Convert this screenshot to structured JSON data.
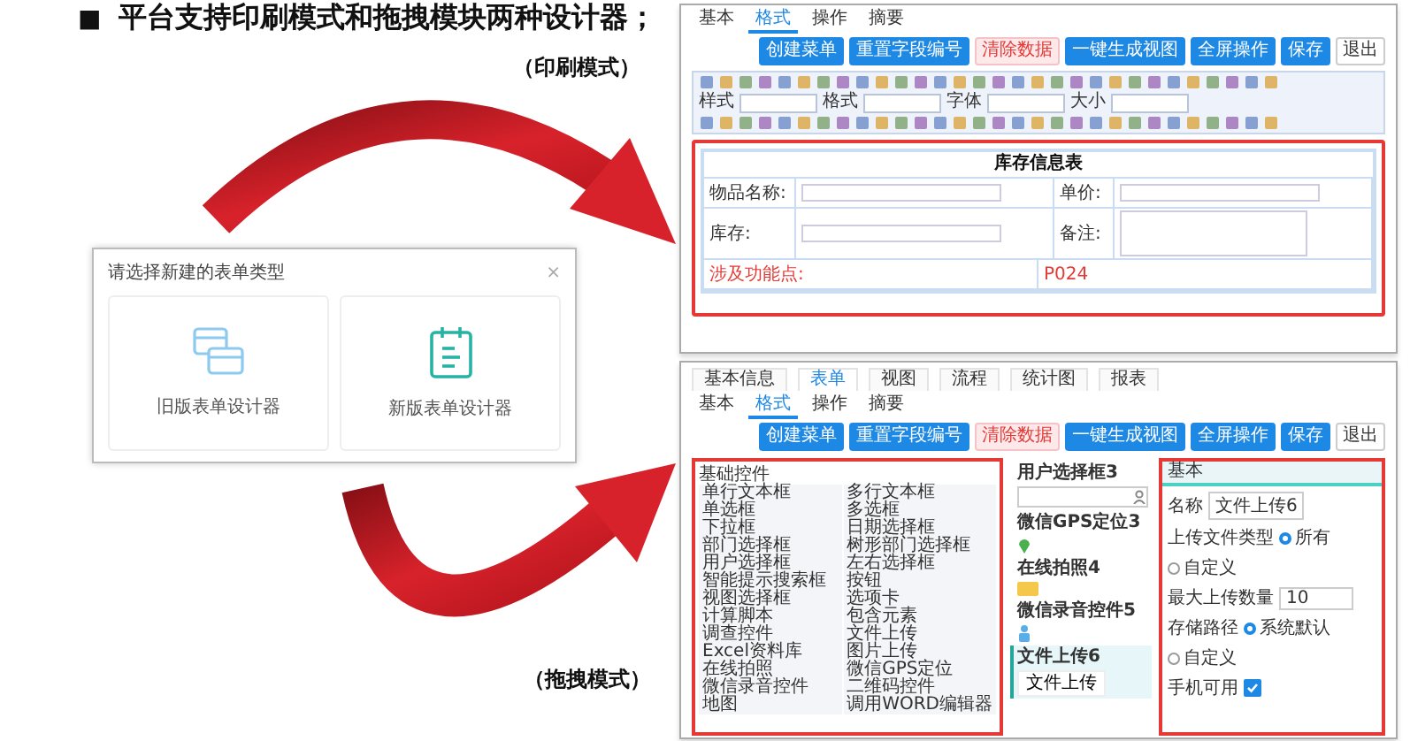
{
  "heading": {
    "bullet": "■",
    "text": "平台支持印刷模式和拖拽模块两种设计器；"
  },
  "mode_labels": [
    "（印刷模式）",
    "（拖拽模式）"
  ],
  "print_designer": {
    "sub_tabs": [
      {
        "label": "基本",
        "selected": false
      },
      {
        "label": "格式",
        "selected": true
      },
      {
        "label": "操作",
        "selected": false
      },
      {
        "label": "摘要",
        "selected": false
      }
    ],
    "buttons": [
      {
        "label": "创建菜单",
        "kind": "primary"
      },
      {
        "label": "重置字段编号",
        "kind": "primary"
      },
      {
        "label": "清除数据",
        "kind": "danger"
      },
      {
        "label": "一键生成视图",
        "kind": "primary"
      },
      {
        "label": "全屏操作",
        "kind": "primary"
      },
      {
        "label": "保存",
        "kind": "primary"
      },
      {
        "label": "退出",
        "kind": "plain"
      }
    ],
    "toolbar_fields": [
      "样式",
      "格式",
      "字体",
      "大小"
    ],
    "form": {
      "title": "库存信息表",
      "rows": [
        {
          "kind": "pair",
          "cells": [
            {
              "label": "物品名称:",
              "kind": "input"
            },
            {
              "label": "单价:",
              "kind": "input"
            }
          ]
        },
        {
          "kind": "pair",
          "cells": [
            {
              "label": "库存:",
              "kind": "input"
            },
            {
              "label": "备注:",
              "kind": "textarea"
            }
          ]
        },
        {
          "kind": "note",
          "label": "涉及功能点:",
          "value": "P024"
        }
      ]
    }
  },
  "dialog": {
    "title": "请选择新建的表单类型",
    "close": "×",
    "options": [
      {
        "label": "旧版表单设计器",
        "kind": "old"
      },
      {
        "label": "新版表单设计器",
        "kind": "new"
      }
    ]
  },
  "drag_designer": {
    "top_tabs": [
      {
        "label": "基本信息",
        "selected": false
      },
      {
        "label": "表单",
        "selected": true
      },
      {
        "label": "视图",
        "selected": false
      },
      {
        "label": "流程",
        "selected": false
      },
      {
        "label": "统计图",
        "selected": false
      },
      {
        "label": "报表",
        "selected": false
      }
    ],
    "sub_tabs": [
      {
        "label": "基本",
        "selected": false
      },
      {
        "label": "格式",
        "selected": true
      },
      {
        "label": "操作",
        "selected": false
      },
      {
        "label": "摘要",
        "selected": false
      }
    ],
    "buttons": [
      {
        "label": "创建菜单",
        "kind": "primary"
      },
      {
        "label": "重置字段编号",
        "kind": "primary"
      },
      {
        "label": "清除数据",
        "kind": "danger"
      },
      {
        "label": "一键生成视图",
        "kind": "primary"
      },
      {
        "label": "全屏操作",
        "kind": "primary"
      },
      {
        "label": "保存",
        "kind": "primary"
      },
      {
        "label": "退出",
        "kind": "plain"
      }
    ],
    "palette": {
      "title": "基础控件",
      "items": [
        "单行文本框",
        "多行文本框",
        "单选框",
        "多选框",
        "下拉框",
        "日期选择框",
        "部门选择框",
        "树形部门选择框",
        "用户选择框",
        "左右选择框",
        "智能提示搜索框",
        "按钮",
        "视图选择框",
        "选项卡",
        "计算脚本",
        "包含元素",
        "调查控件",
        "文件上传",
        "Excel资料库",
        "图片上传",
        "在线拍照",
        "微信GPS定位",
        "微信录音控件",
        "二维码控件",
        "地图",
        "调用WORD编辑器"
      ]
    },
    "canvas_fields": [
      {
        "label": "用户选择框3",
        "kind": "user",
        "selected": false
      },
      {
        "label": "微信GPS定位3",
        "kind": "gps",
        "selected": false
      },
      {
        "label": "在线拍照4",
        "kind": "photo",
        "selected": false
      },
      {
        "label": "微信录音控件5",
        "kind": "audio",
        "selected": false
      },
      {
        "label": "文件上传6",
        "kind": "file",
        "button": "文件上传",
        "selected": true
      }
    ],
    "properties": {
      "title": "基本",
      "rows": [
        {
          "kind": "text",
          "label": "名称",
          "value": "文件上传6"
        },
        {
          "kind": "radio",
          "label": "上传文件类型",
          "options": [
            {
              "label": "所有",
              "selected": true
            },
            {
              "label": "自定义",
              "selected": false
            }
          ]
        },
        {
          "kind": "number",
          "label": "最大上传数量",
          "value": "10"
        },
        {
          "kind": "radio",
          "label": "存储路径",
          "options": [
            {
              "label": "系统默认",
              "selected": true
            },
            {
              "label": "自定义",
              "selected": false
            }
          ]
        },
        {
          "kind": "check",
          "label": "手机可用",
          "checked": true
        }
      ]
    }
  }
}
